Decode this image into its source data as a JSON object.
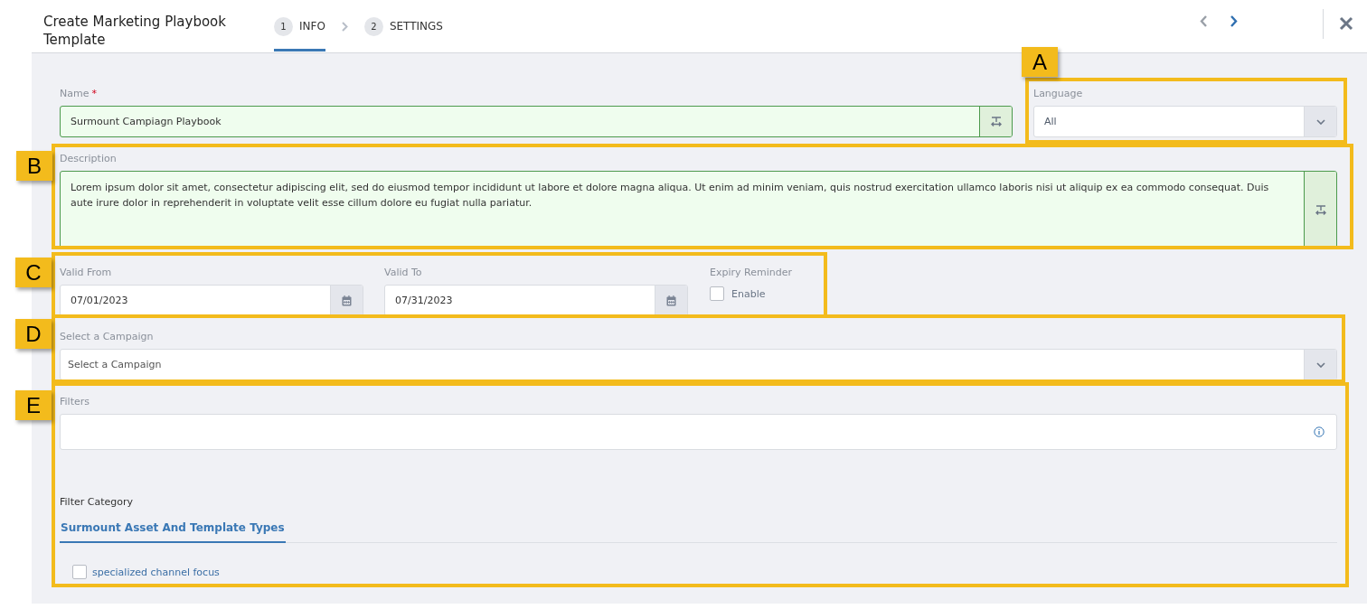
{
  "header": {
    "title": "Create Marketing Playbook Template",
    "steps": [
      {
        "number": "1",
        "label": "INFO",
        "selected": true
      },
      {
        "number": "2",
        "label": "SETTINGS",
        "selected": false
      }
    ],
    "nav": {
      "previous": {
        "disabled": true
      },
      "next": {
        "disabled": false
      }
    }
  },
  "form": {
    "name": {
      "label": "Name",
      "required_mark": "*",
      "value": "Surmount Campiagn Playbook",
      "valid": true
    },
    "language": {
      "label": "Language",
      "value": "All"
    },
    "description": {
      "label": "Description",
      "value": "Lorem ipsum dolor sit amet, consectetur adipiscing elit, sed do eiusmod tempor incididunt ut labore et dolore magna aliqua. Ut enim ad minim veniam, quis nostrud exercitation ullamco laboris nisi ut aliquip ex ea commodo consequat. Duis aute irure dolor in reprehenderit in voluptate velit esse cillum dolore eu fugiat nulla pariatur.",
      "valid": true
    },
    "valid_from": {
      "label": "Valid From",
      "value": "07/01/2023"
    },
    "valid_to": {
      "label": "Valid To",
      "value": "07/31/2023"
    },
    "expiry_reminder": {
      "label": "Expiry Reminder",
      "option": "Enable",
      "checked": false
    },
    "campaign": {
      "label": "Select a Campaign",
      "placeholder": "Select a Campaign"
    },
    "filters": {
      "label": "Filters"
    },
    "filter_category": {
      "label": "Filter Category",
      "tabs": [
        {
          "label": "Surmount Asset And Template Types",
          "selected": true
        }
      ],
      "options": [
        {
          "label": "specialized channel focus",
          "checked": false
        }
      ]
    }
  },
  "callouts": [
    {
      "label": "A"
    },
    {
      "label": "B"
    },
    {
      "label": "C"
    },
    {
      "label": "D"
    },
    {
      "label": "E"
    }
  ]
}
